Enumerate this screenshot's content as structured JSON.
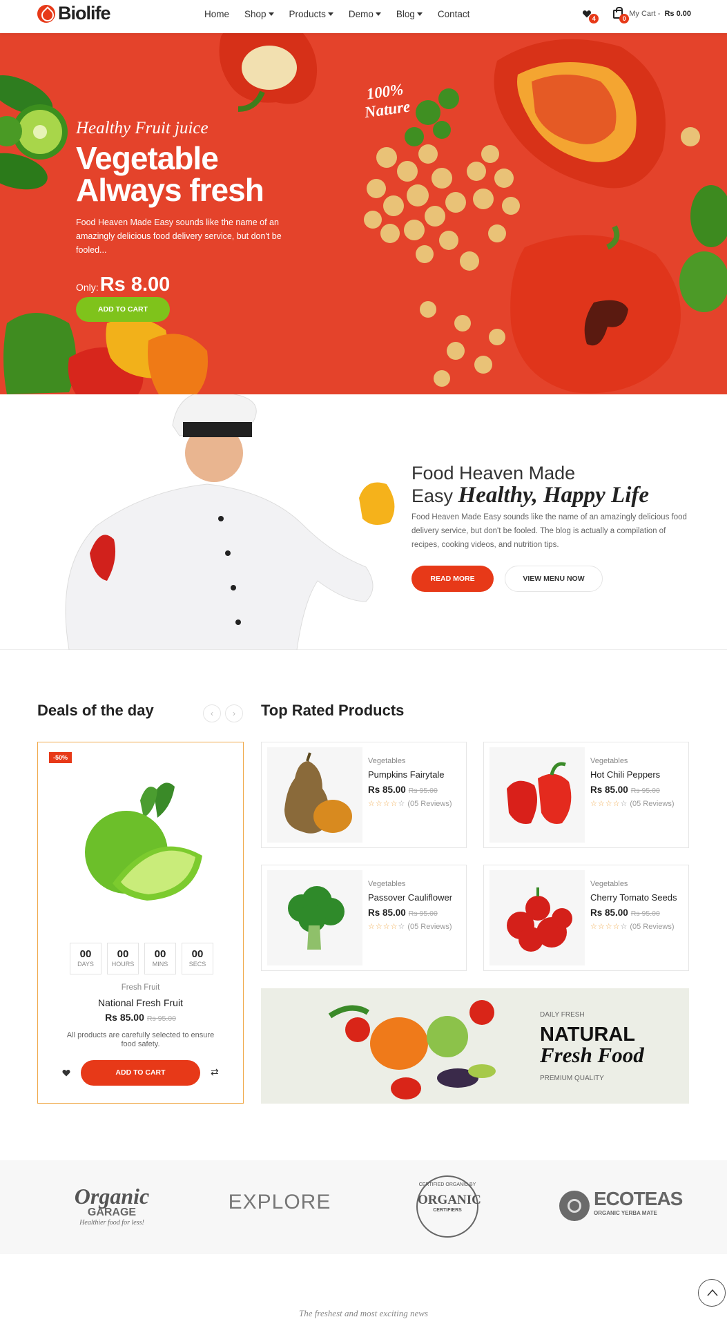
{
  "header": {
    "logo": "Biolife",
    "nav": [
      {
        "label": "Home",
        "caret": false
      },
      {
        "label": "Shop",
        "caret": true
      },
      {
        "label": "Products",
        "caret": true
      },
      {
        "label": "Demo",
        "caret": true
      },
      {
        "label": "Blog",
        "caret": true
      },
      {
        "label": "Contact",
        "caret": false
      }
    ],
    "wishlist_count": "4",
    "cart_count": "0",
    "cart_label": "My Cart -",
    "cart_total": "Rs 0.00"
  },
  "hero": {
    "subtitle": "Healthy Fruit juice",
    "title_line1": "Vegetable",
    "title_line2": "Always fresh",
    "description": "Food Heaven Made Easy sounds like the name of an amazingly delicious food delivery service, but don't be fooled...",
    "price_prefix": "Only:",
    "price": "Rs 8.00",
    "button": "ADD TO CART",
    "stamp_line1": "100%",
    "stamp_line2": "Nature"
  },
  "about": {
    "heading_plain_1": "Food Heaven Made",
    "heading_plain_2": "Easy",
    "heading_italic": "Healthy, Happy Life",
    "text": "Food Heaven Made Easy sounds like the name of an amazingly delicious food delivery service, but don't be fooled. The blog is actually a compilation of recipes, cooking videos, and nutrition tips.",
    "btn_primary": "READ MORE",
    "btn_secondary": "VIEW MENU NOW"
  },
  "deals": {
    "heading": "Deals of the day",
    "badge": "-50%",
    "timer": [
      {
        "value": "00",
        "unit": "DAYS"
      },
      {
        "value": "00",
        "unit": "HOURS"
      },
      {
        "value": "00",
        "unit": "MINS"
      },
      {
        "value": "00",
        "unit": "SECS"
      }
    ],
    "category": "Fresh Fruit",
    "name": "National Fresh Fruit",
    "price": "Rs 85.00",
    "old_price": "Rs 95.00",
    "note": "All products are carefully selected to ensure food safety.",
    "button": "ADD TO CART"
  },
  "top_rated": {
    "heading": "Top Rated Products",
    "products": [
      {
        "category": "Vegetables",
        "name": "Pumpkins Fairytale",
        "price": "Rs 85.00",
        "old_price": "Rs 95.00",
        "reviews": "(05 Reviews)",
        "rating": 0
      },
      {
        "category": "Vegetables",
        "name": "Hot Chili Peppers",
        "price": "Rs 85.00",
        "old_price": "Rs 95.00",
        "reviews": "(05 Reviews)",
        "rating": 0
      },
      {
        "category": "Vegetables",
        "name": "Passover Cauliflower",
        "price": "Rs 85.00",
        "old_price": "Rs 95.00",
        "reviews": "(05 Reviews)",
        "rating": 0
      },
      {
        "category": "Vegetables",
        "name": "Cherry Tomato Seeds",
        "price": "Rs 85.00",
        "old_price": "Rs 95.00",
        "reviews": "(05 Reviews)",
        "rating": 0
      }
    ]
  },
  "banner": {
    "kicker": "DAILY FRESH",
    "title_line1": "NATURAL",
    "title_line2": "Fresh Food",
    "footer": "PREMIUM QUALITY"
  },
  "brands": [
    {
      "name": "Organic",
      "sub": "GARAGE",
      "tag": "Healthier food for less!"
    },
    {
      "name": "EXPLORE",
      "sub": "",
      "tag": ""
    },
    {
      "name": "ORGANIC",
      "sub": "CERTIFIERS",
      "tag": "CERTIFIED ORGANIC BY"
    },
    {
      "name": "ECOTEAS",
      "sub": "ORGANIC YERBA MATE",
      "tag": ""
    }
  ],
  "news_tagline": "The freshest and most exciting news",
  "colors": {
    "accent": "#e73918",
    "hero_bg": "#e4432b",
    "green": "#7fc31b",
    "deal_border": "#f0a94a"
  }
}
